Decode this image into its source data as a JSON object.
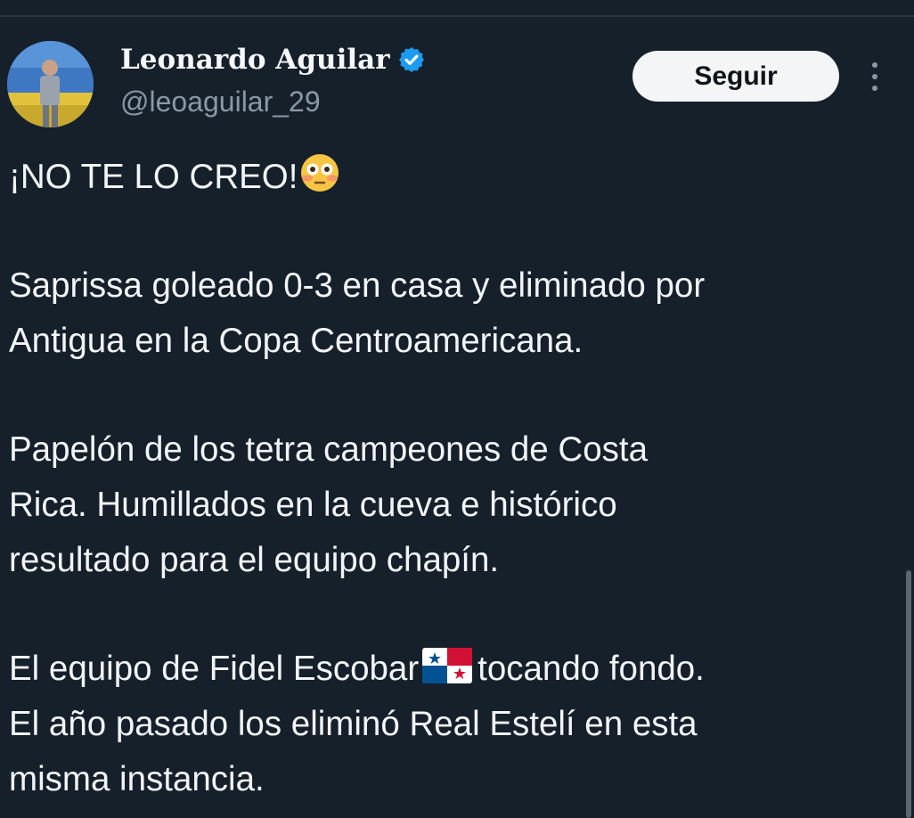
{
  "author": {
    "display_name": "Leonardo Aguilar",
    "handle": "@leoaguilar_29",
    "verified": true,
    "verified_icon": "verified-badge-icon"
  },
  "actions": {
    "follow_label": "Seguir",
    "more_icon": "more-vertical-icon"
  },
  "tweet": {
    "lines": [
      "¡NO TE LO CREO!",
      "Saprissa goleado 0-3 en casa y eliminado por",
      "Antigua en la Copa Centroamericana.",
      "Papelón de los tetra campeones de Costa",
      "Rica. Humillados en la cueva e histórico",
      "resultado para el equipo chapín.",
      "El equipo de Fidel Escobar",
      "tocando fondo.",
      "El año pasado los eliminó Real Estelí en esta",
      "misma instancia."
    ],
    "emoji_1": "flushed-face-emoji",
    "emoji_2": "panama-flag-emoji"
  },
  "colors": {
    "background": "#15202b",
    "text": "#f2f5f7",
    "secondary_text": "#8b98a5",
    "verified_blue": "#1d9bf0",
    "follow_button_bg": "#f4f5f6"
  }
}
